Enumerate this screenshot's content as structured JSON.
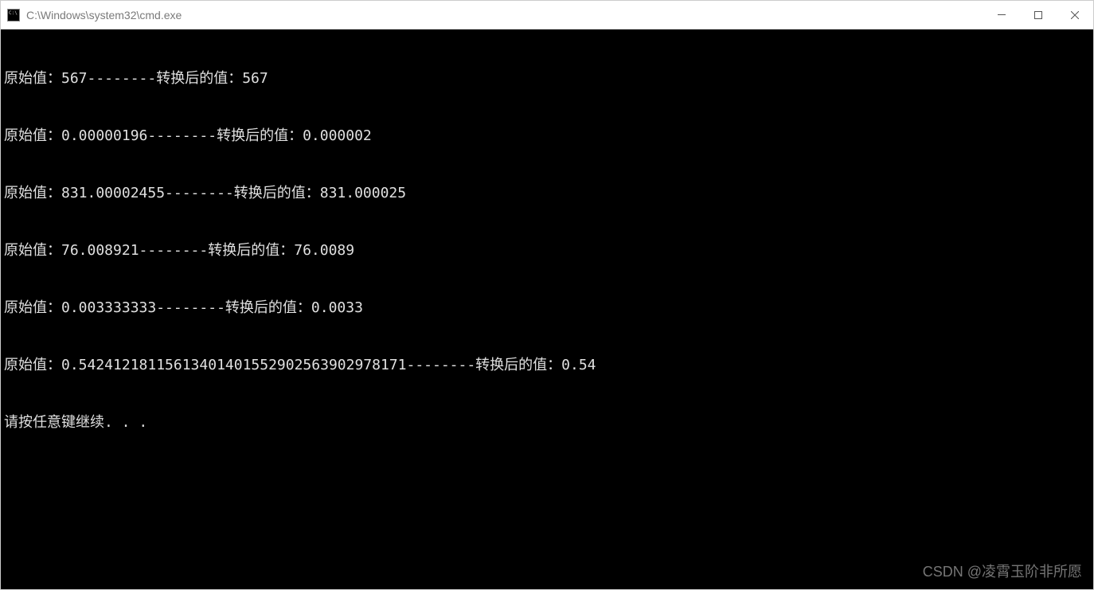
{
  "window": {
    "title": "C:\\Windows\\system32\\cmd.exe"
  },
  "terminal": {
    "lines": [
      "原始值：567--------转换后的值：567",
      "原始值：0.00000196--------转换后的值：0.000002",
      "原始值：831.00002455--------转换后的值：831.000025",
      "原始值：76.008921--------转换后的值：76.0089",
      "原始值：0.003333333--------转换后的值：0.0033",
      "原始值：0.54241218115613401401552902563902978171--------转换后的值：0.54",
      "请按任意键继续. . ."
    ]
  },
  "watermark": {
    "text": "CSDN @凌霄玉阶非所愿"
  }
}
